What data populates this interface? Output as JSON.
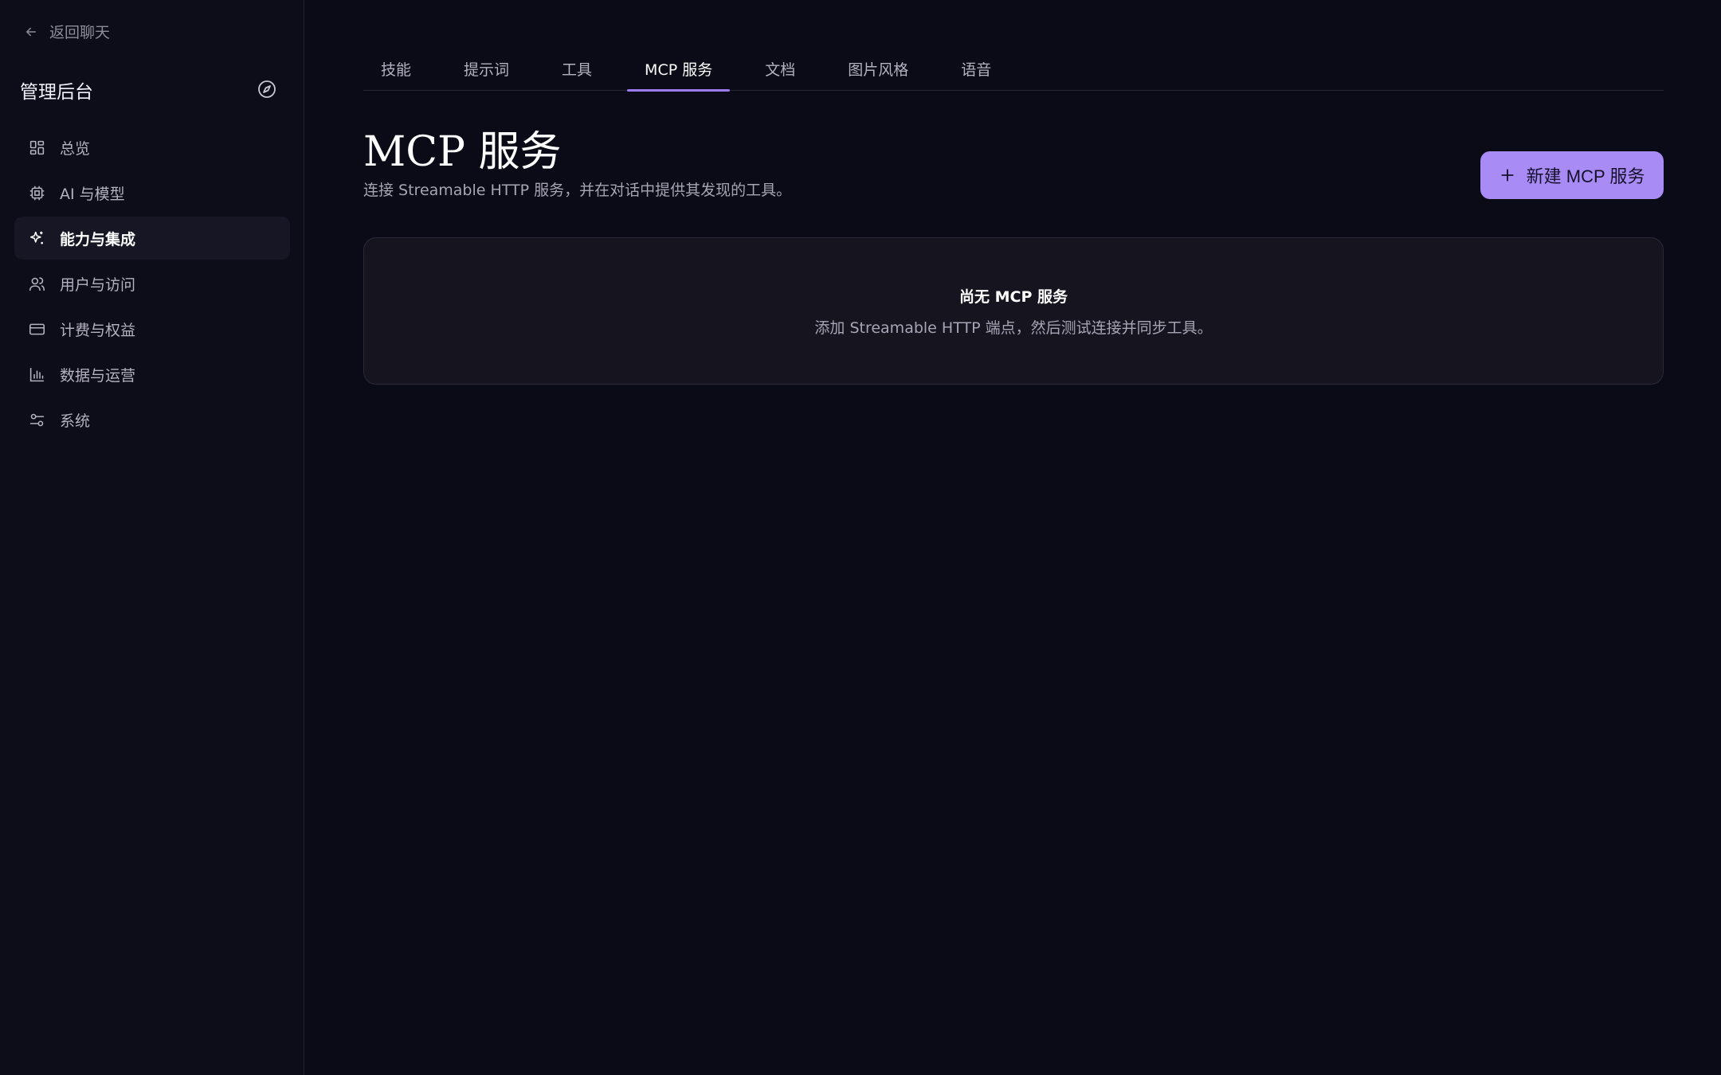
{
  "sidebar": {
    "back_label": "返回聊天",
    "title": "管理后台",
    "items": [
      {
        "label": "总览",
        "icon": "dashboard-grid-icon"
      },
      {
        "label": "AI 与模型",
        "icon": "cpu-chip-icon"
      },
      {
        "label": "能力与集成",
        "icon": "sparkle-icon",
        "active": true
      },
      {
        "label": "用户与访问",
        "icon": "users-icon"
      },
      {
        "label": "计费与权益",
        "icon": "credit-card-icon"
      },
      {
        "label": "数据与运营",
        "icon": "bar-chart-icon"
      },
      {
        "label": "系统",
        "icon": "sliders-icon"
      }
    ]
  },
  "tabs": [
    {
      "label": "技能"
    },
    {
      "label": "提示词"
    },
    {
      "label": "工具"
    },
    {
      "label": "MCP 服务",
      "active": true
    },
    {
      "label": "文档"
    },
    {
      "label": "图片风格"
    },
    {
      "label": "语音"
    }
  ],
  "main": {
    "title": "MCP 服务",
    "subtitle": "连接 Streamable HTTP 服务，并在对话中提供其发现的工具。",
    "new_button_label": "新建 MCP 服务",
    "empty_title": "尚无 MCP 服务",
    "empty_desc": "添加 Streamable HTTP 端点，然后测试连接并同步工具。"
  },
  "colors": {
    "accent": "#a98bf6",
    "tab_indicator": "#9b7bf0",
    "background": "#0b0a17"
  }
}
